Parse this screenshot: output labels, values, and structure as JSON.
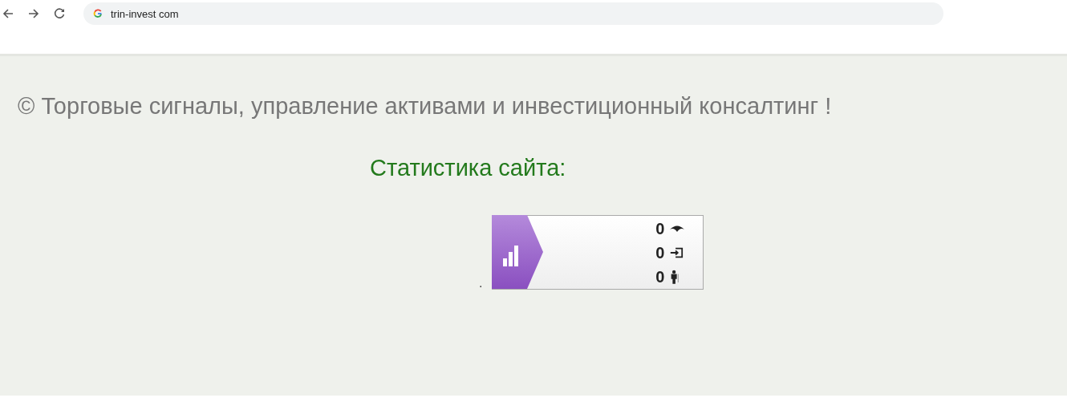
{
  "browser": {
    "url": "trin-invest com"
  },
  "page": {
    "tagline": "© Торговые сигналы, управление активами и инвестиционный консалтинг !",
    "stats_title": "Статистика сайта:",
    "separator": "."
  },
  "counter": {
    "rows": [
      {
        "kind": "views",
        "value": "0"
      },
      {
        "kind": "visits",
        "value": "0"
      },
      {
        "kind": "visitors",
        "value": "0"
      }
    ]
  }
}
